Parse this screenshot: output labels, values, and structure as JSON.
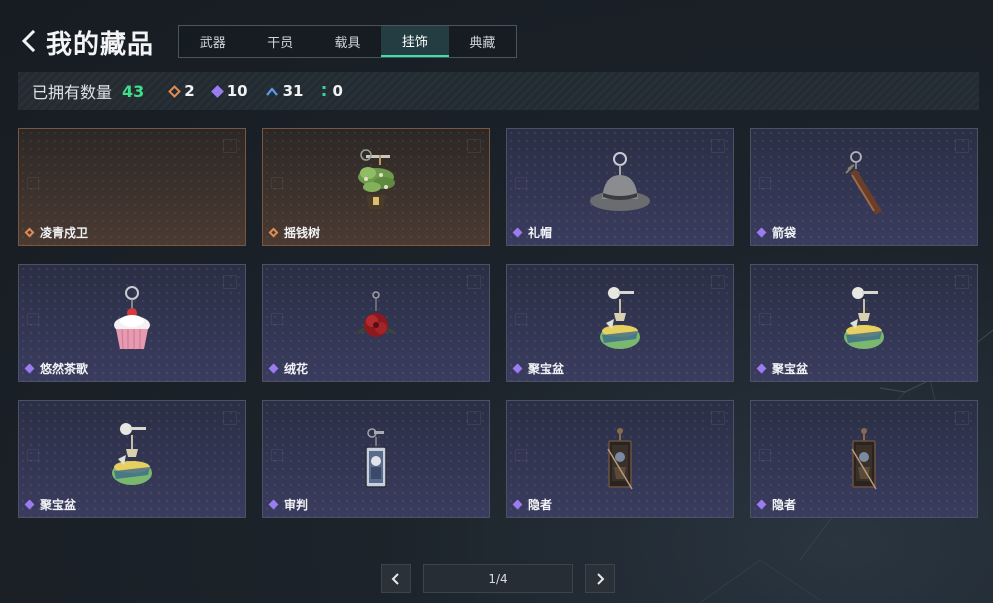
{
  "header": {
    "title": "我的藏品"
  },
  "tabs": [
    {
      "label": "武器",
      "active": false
    },
    {
      "label": "干员",
      "active": false
    },
    {
      "label": "载具",
      "active": false
    },
    {
      "label": "挂饰",
      "active": true
    },
    {
      "label": "典藏",
      "active": false
    }
  ],
  "owned": {
    "label": "已拥有数量",
    "total": "43",
    "rarities": [
      {
        "icon": "orange-rarity-icon",
        "color": "#e08a55",
        "count": "2"
      },
      {
        "icon": "purple-rarity-icon",
        "color": "#9a7cf0",
        "count": "10"
      },
      {
        "icon": "blue-rarity-icon",
        "color": "#5a9ae8",
        "count": "31"
      },
      {
        "icon": "green-rarity-icon",
        "color": "#3fd0a0",
        "count": "0"
      }
    ]
  },
  "items": [
    {
      "name": "凌青戍卫",
      "rarity": "orange",
      "icon": "empty"
    },
    {
      "name": "摇钱树",
      "rarity": "orange",
      "icon": "money-tree-charm-icon"
    },
    {
      "name": "礼帽",
      "rarity": "purple",
      "icon": "fedora-hat-charm-icon"
    },
    {
      "name": "箭袋",
      "rarity": "purple",
      "icon": "quiver-charm-icon"
    },
    {
      "name": "悠然茶歌",
      "rarity": "purple",
      "icon": "cupcake-charm-icon"
    },
    {
      "name": "绒花",
      "rarity": "purple",
      "icon": "velvet-flower-charm-icon"
    },
    {
      "name": "聚宝盆",
      "rarity": "purple",
      "icon": "treasure-bowl-charm-icon"
    },
    {
      "name": "聚宝盆",
      "rarity": "purple",
      "icon": "treasure-bowl-charm-icon"
    },
    {
      "name": "聚宝盆",
      "rarity": "purple",
      "icon": "treasure-bowl-charm-icon"
    },
    {
      "name": "审判",
      "rarity": "purple",
      "icon": "judgement-card-charm-icon"
    },
    {
      "name": "隐者",
      "rarity": "purple",
      "icon": "hermit-card-charm-icon"
    },
    {
      "name": "隐者",
      "rarity": "purple",
      "icon": "hermit-card-charm-icon"
    }
  ],
  "pagination": {
    "text": "1/4",
    "prev": "chevron-left-icon",
    "next": "chevron-right-icon"
  },
  "colors": {
    "accent_green": "#3fe08c",
    "tab_active": "#3fe0a8",
    "orange": "#e08a55",
    "purple": "#9a7cf0"
  }
}
